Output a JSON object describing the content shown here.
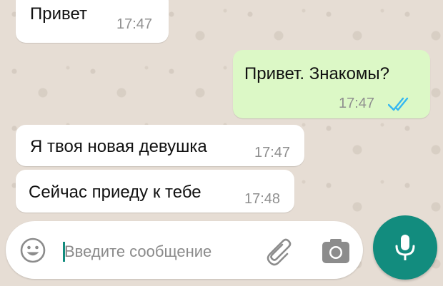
{
  "messages": [
    {
      "text": "Привет",
      "time": "17:47"
    },
    {
      "text": "Привет. Знакомы?",
      "time": "17:47"
    },
    {
      "text": "Я твоя новая девушка",
      "time": "17:47"
    },
    {
      "text": "Сейчас приеду к тебе",
      "time": "17:48"
    }
  ],
  "composer": {
    "placeholder": "Введите сообщение"
  },
  "icons": {
    "emoji": "emoji-icon",
    "attach": "paperclip-icon",
    "camera": "camera-icon",
    "mic": "microphone-icon",
    "read": "double-check-icon"
  },
  "colors": {
    "incoming": "#ffffff",
    "outgoing": "#dcf8c6",
    "accent": "#128c7e",
    "read_ticks": "#34b7f1",
    "background": "#e6ddd4"
  }
}
